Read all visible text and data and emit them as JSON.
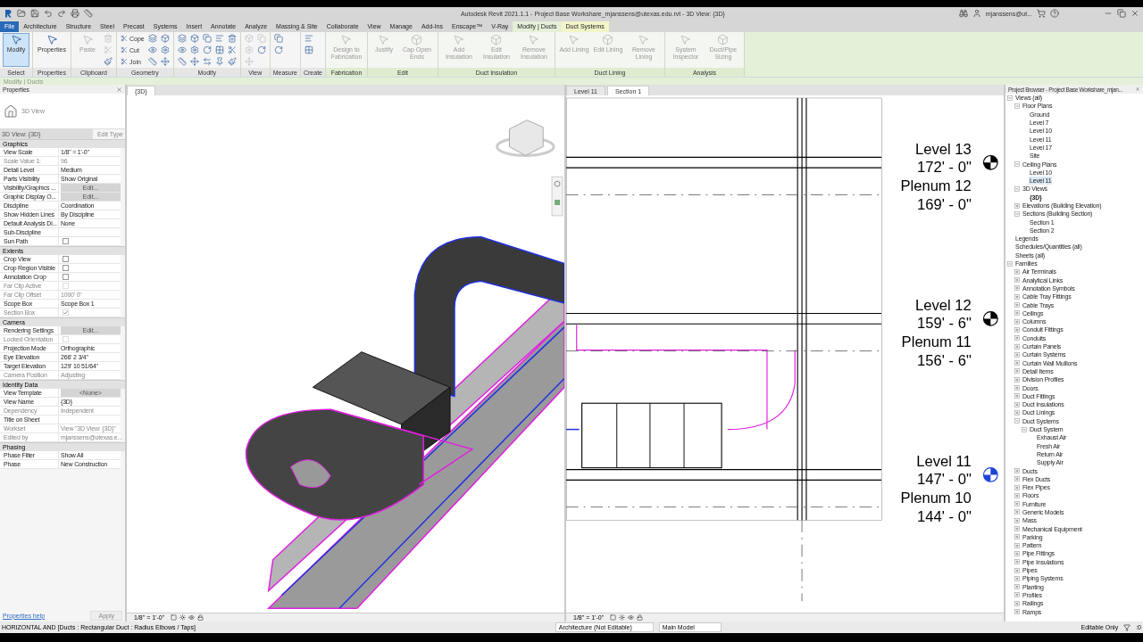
{
  "title_bar": {
    "title": "Autodesk Revit 2021.1.1 - Project Base Workshare_mjanssens@utexas.edu.rvt - 3D View: {3D}",
    "user": "mjanssens@ut..."
  },
  "ribbon_tabs": [
    {
      "label": "File",
      "kind": "file",
      "selected": false
    },
    {
      "label": "Architecture",
      "kind": "normal",
      "selected": false
    },
    {
      "label": "Structure",
      "kind": "normal",
      "selected": false
    },
    {
      "label": "Steel",
      "kind": "normal",
      "selected": false
    },
    {
      "label": "Precast",
      "kind": "normal",
      "selected": false
    },
    {
      "label": "Systems",
      "kind": "normal",
      "selected": false
    },
    {
      "label": "Insert",
      "kind": "normal",
      "selected": false
    },
    {
      "label": "Annotate",
      "kind": "normal",
      "selected": false
    },
    {
      "label": "Analyze",
      "kind": "normal",
      "selected": false
    },
    {
      "label": "Massing & Site",
      "kind": "normal",
      "selected": false
    },
    {
      "label": "Collaborate",
      "kind": "normal",
      "selected": false
    },
    {
      "label": "View",
      "kind": "normal",
      "selected": false
    },
    {
      "label": "Manage",
      "kind": "normal",
      "selected": false
    },
    {
      "label": "Add-Ins",
      "kind": "normal",
      "selected": false
    },
    {
      "label": "Enscape™",
      "kind": "normal",
      "selected": false
    },
    {
      "label": "V-Ray",
      "kind": "normal",
      "selected": false
    },
    {
      "label": "Modify | Ducts",
      "kind": "contextual",
      "selected": true
    },
    {
      "label": "Duct Systems",
      "kind": "contextual",
      "selected": false
    }
  ],
  "ribbon_panels": [
    {
      "label": "Select",
      "kind": "general",
      "tools": [
        {
          "kind": "large",
          "label": "Modify",
          "disabled": false,
          "selected": true
        }
      ]
    },
    {
      "label": "Properties",
      "kind": "general",
      "tools": [
        {
          "kind": "large",
          "label": "Properties",
          "disabled": false,
          "selected": false
        }
      ]
    },
    {
      "label": "Clipboard",
      "kind": "general",
      "tools": [
        {
          "kind": "large",
          "label": "Paste",
          "disabled": true,
          "selected": false
        },
        {
          "kind": "icon",
          "disabled": true
        },
        {
          "kind": "icon",
          "disabled": true
        },
        {
          "kind": "icon",
          "disabled": false
        }
      ]
    },
    {
      "label": "Geometry",
      "kind": "general",
      "tools": [
        {
          "kind": "small",
          "label": "Cope",
          "disabled": false
        },
        {
          "kind": "small",
          "label": "Cut",
          "disabled": false
        },
        {
          "kind": "small",
          "label": "Join",
          "disabled": false
        },
        {
          "kind": "icon",
          "disabled": false
        },
        {
          "kind": "icon",
          "disabled": false
        },
        {
          "kind": "icon",
          "disabled": false
        },
        {
          "kind": "icon",
          "disabled": false
        },
        {
          "kind": "icon",
          "disabled": false
        },
        {
          "kind": "icon",
          "disabled": false
        }
      ]
    },
    {
      "label": "Modify",
      "kind": "general",
      "tools": [
        {
          "kind": "icon",
          "disabled": false
        },
        {
          "kind": "icon",
          "disabled": false
        },
        {
          "kind": "icon",
          "disabled": false
        },
        {
          "kind": "icon",
          "disabled": false
        },
        {
          "kind": "icon",
          "disabled": false
        },
        {
          "kind": "icon",
          "disabled": false
        },
        {
          "kind": "icon",
          "disabled": false
        },
        {
          "kind": "icon",
          "disabled": false
        },
        {
          "kind": "icon",
          "disabled": false
        },
        {
          "kind": "icon",
          "disabled": false
        },
        {
          "kind": "icon",
          "disabled": false
        },
        {
          "kind": "icon",
          "disabled": false
        },
        {
          "kind": "icon",
          "disabled": false
        },
        {
          "kind": "icon",
          "disabled": false
        },
        {
          "kind": "icon",
          "disabled": false
        }
      ]
    },
    {
      "label": "View",
      "kind": "general",
      "tools": [
        {
          "kind": "icon",
          "disabled": true
        },
        {
          "kind": "icon",
          "disabled": true
        },
        {
          "kind": "icon",
          "disabled": true
        },
        {
          "kind": "icon",
          "disabled": true
        },
        {
          "kind": "icon",
          "disabled": false
        }
      ]
    },
    {
      "label": "Measure",
      "kind": "general",
      "tools": [
        {
          "kind": "icon",
          "disabled": false
        },
        {
          "kind": "icon",
          "disabled": false
        }
      ]
    },
    {
      "label": "Create",
      "kind": "general",
      "tools": [
        {
          "kind": "icon",
          "disabled": false
        },
        {
          "kind": "icon",
          "disabled": false
        }
      ]
    },
    {
      "label": "Fabrication",
      "kind": "contextual",
      "tools": [
        {
          "kind": "large",
          "label": "Design to Fabrication",
          "disabled": true,
          "selected": false
        }
      ]
    },
    {
      "label": "Edit",
      "kind": "contextual",
      "tools": [
        {
          "kind": "large",
          "label": "Justify",
          "disabled": true,
          "selected": false
        },
        {
          "kind": "large",
          "label": "Cap Open Ends",
          "disabled": true,
          "selected": false
        }
      ]
    },
    {
      "label": "Duct Insulation",
      "kind": "contextual",
      "tools": [
        {
          "kind": "large",
          "label": "Add Insulation",
          "disabled": true,
          "selected": false
        },
        {
          "kind": "large",
          "label": "Edit Insulation",
          "disabled": true,
          "selected": false
        },
        {
          "kind": "large",
          "label": "Remove Insulation",
          "disabled": true,
          "selected": false
        }
      ]
    },
    {
      "label": "Duct Lining",
      "kind": "contextual",
      "tools": [
        {
          "kind": "large",
          "label": "Add Lining",
          "disabled": true,
          "selected": false
        },
        {
          "kind": "large",
          "label": "Edit Lining",
          "disabled": true,
          "selected": false
        },
        {
          "kind": "large",
          "label": "Remove Lining",
          "disabled": true,
          "selected": false
        }
      ]
    },
    {
      "label": "Analysis",
      "kind": "contextual",
      "tools": [
        {
          "kind": "large",
          "label": "System Inspector",
          "disabled": true,
          "selected": false
        },
        {
          "kind": "large",
          "label": "Duct/Pipe Sizing",
          "disabled": true,
          "selected": false
        }
      ]
    }
  ],
  "context_bar": "Modify | Ducts",
  "properties": {
    "title": "Properties",
    "type_name": "3D View",
    "instance": "3D View: {3D}",
    "edit_type": "Edit Type",
    "groups": [
      {
        "title": "Graphics",
        "rows": [
          {
            "label": "View Scale",
            "value": "1/8\" = 1'-0\"",
            "kind": "text",
            "disabled": false
          },
          {
            "label": "Scale Value    1:",
            "value": "96",
            "kind": "text",
            "disabled": true
          },
          {
            "label": "Detail Level",
            "value": "Medium",
            "kind": "text",
            "disabled": false
          },
          {
            "label": "Parts Visibility",
            "value": "Show Original",
            "kind": "text",
            "disabled": false
          },
          {
            "label": "Visibility/Graphics ...",
            "value": "Edit...",
            "kind": "button",
            "disabled": false
          },
          {
            "label": "Graphic Display O...",
            "value": "Edit...",
            "kind": "button",
            "disabled": false
          },
          {
            "label": "Discipline",
            "value": "Coordination",
            "kind": "text",
            "disabled": false
          },
          {
            "label": "Show Hidden Lines",
            "value": "By Discipline",
            "kind": "text",
            "disabled": false
          },
          {
            "label": "Default Analysis Di...",
            "value": "None",
            "kind": "text",
            "disabled": false
          },
          {
            "label": "Sub-Discipline",
            "kind": "text",
            "disabled": false
          },
          {
            "label": "Sun Path",
            "kind": "checkbox",
            "checked": false,
            "disabled": false
          }
        ]
      },
      {
        "title": "Extents",
        "rows": [
          {
            "label": "Crop View",
            "kind": "checkbox",
            "checked": false,
            "disabled": false
          },
          {
            "label": "Crop Region Visible",
            "kind": "checkbox",
            "checked": false,
            "disabled": false
          },
          {
            "label": "Annotation Crop",
            "kind": "checkbox",
            "checked": false,
            "disabled": false
          },
          {
            "label": "Far Clip Active",
            "kind": "checkbox",
            "checked": false,
            "disabled": true
          },
          {
            "label": "Far Clip Offset",
            "value": "1000'  0\"",
            "kind": "text",
            "disabled": true
          },
          {
            "label": "Scope Box",
            "value": "Scope Box 1",
            "kind": "text",
            "disabled": false
          },
          {
            "label": "Section Box",
            "kind": "checkbox",
            "checked": true,
            "disabled": true
          }
        ]
      },
      {
        "title": "Camera",
        "rows": [
          {
            "label": "Rendering Settings",
            "value": "Edit...",
            "kind": "button",
            "disabled": false
          },
          {
            "label": "Locked Orientation",
            "kind": "checkbox",
            "checked": false,
            "disabled": true
          },
          {
            "label": "Projection Mode",
            "value": "Orthographic",
            "kind": "text",
            "disabled": false
          },
          {
            "label": "Eye Elevation",
            "value": "266'  2 3/4\"",
            "kind": "text",
            "disabled": false
          },
          {
            "label": "Target Elevation",
            "value": "129'  10 51/64\"",
            "kind": "text",
            "disabled": false
          },
          {
            "label": "Camera Position",
            "value": "Adjusting",
            "kind": "text",
            "disabled": true
          }
        ]
      },
      {
        "title": "Identity Data",
        "rows": [
          {
            "label": "View Template",
            "value": "<None>",
            "kind": "button",
            "disabled": false
          },
          {
            "label": "View Name",
            "value": "{3D}",
            "kind": "text",
            "disabled": false
          },
          {
            "label": "Dependency",
            "value": "Independent",
            "kind": "text",
            "disabled": true
          },
          {
            "label": "Title on Sheet",
            "kind": "text",
            "disabled": false
          },
          {
            "label": "Workset",
            "value": "View \"3D View: {3D}\"",
            "kind": "text",
            "disabled": true
          },
          {
            "label": "Edited by",
            "value": "mjanssens@utexas.e...",
            "kind": "text",
            "disabled": true
          }
        ]
      },
      {
        "title": "Phasing",
        "rows": [
          {
            "label": "Phase Filter",
            "value": "Show All",
            "kind": "text",
            "disabled": false
          },
          {
            "label": "Phase",
            "value": "New Construction",
            "kind": "text",
            "disabled": false
          }
        ]
      }
    ],
    "help_link": "Properties help",
    "apply": "Apply"
  },
  "view_3d": {
    "tabs": [
      {
        "label": "{3D}",
        "selected": true
      }
    ],
    "scale": "1/8\" = 1'-0\""
  },
  "section_view": {
    "tabs": [
      {
        "label": "Level 11",
        "selected": false
      },
      {
        "label": "Section 1",
        "selected": true
      }
    ],
    "scale": "1/8\" = 1'-0\"",
    "levels": [
      {
        "name": "Level 13",
        "elevation": "172' - 0\"",
        "kind": "level",
        "color": "#000000"
      },
      {
        "name": "Plenum 12",
        "elevation": "169' - 0\"",
        "kind": "plenum"
      },
      {
        "name": "Level 12",
        "elevation": "159' - 6\"",
        "kind": "level",
        "color": "#000000"
      },
      {
        "name": "Plenum 11",
        "elevation": "156' - 6\"",
        "kind": "plenum"
      },
      {
        "name": "Level 11",
        "elevation": "147' - 0\"",
        "kind": "level",
        "color": "#1d46d8"
      },
      {
        "name": "Plenum 10",
        "elevation": "144' - 0\"",
        "kind": "plenum"
      }
    ]
  },
  "project_browser": {
    "title": "Project Browser - Project Base Workshare_mjan...",
    "tree": [
      {
        "label": "Views (all)",
        "expanded": true,
        "selected": false,
        "children": [
          {
            "label": "Floor Plans",
            "expanded": true,
            "selected": false,
            "children": [
              {
                "label": "Ground",
                "selected": false
              },
              {
                "label": "Level 7",
                "selected": false
              },
              {
                "label": "Level 10",
                "selected": false
              },
              {
                "label": "Level 11",
                "selected": false
              },
              {
                "label": "Level 17",
                "selected": false
              },
              {
                "label": "Site",
                "selected": false
              }
            ]
          },
          {
            "label": "Ceiling Plans",
            "expanded": true,
            "selected": false,
            "children": [
              {
                "label": "Level 10",
                "selected": false
              },
              {
                "label": "Level 11",
                "selected": true
              }
            ]
          },
          {
            "label": "3D Views",
            "expanded": true,
            "selected": false,
            "children": [
              {
                "label": "{3D}",
                "selected": false,
                "active": true
              }
            ]
          },
          {
            "label": "Elevations (Building Elevation)",
            "expanded": false,
            "selected": false
          },
          {
            "label": "Sections (Building Section)",
            "expanded": true,
            "selected": false,
            "children": [
              {
                "label": "Section 1",
                "selected": false
              },
              {
                "label": "Section 2",
                "selected": false
              }
            ]
          }
        ]
      },
      {
        "label": "Legends",
        "selected": false
      },
      {
        "label": "Schedules/Quantities (all)",
        "selected": false
      },
      {
        "label": "Sheets (all)",
        "selected": false
      },
      {
        "label": "Families",
        "expanded": true,
        "selected": false,
        "children": [
          {
            "label": "Air Terminals",
            "expanded": false,
            "selected": false
          },
          {
            "label": "Analytical Links",
            "expanded": false,
            "selected": false
          },
          {
            "label": "Annotation Symbols",
            "expanded": false,
            "selected": false
          },
          {
            "label": "Cable Tray Fittings",
            "expanded": false,
            "selected": false
          },
          {
            "label": "Cable Trays",
            "expanded": false,
            "selected": false
          },
          {
            "label": "Ceilings",
            "expanded": false,
            "selected": false
          },
          {
            "label": "Columns",
            "expanded": false,
            "selected": false
          },
          {
            "label": "Conduit Fittings",
            "expanded": false,
            "selected": false
          },
          {
            "label": "Conduits",
            "expanded": false,
            "selected": false
          },
          {
            "label": "Curtain Panels",
            "expanded": false,
            "selected": false
          },
          {
            "label": "Curtain Systems",
            "expanded": false,
            "selected": false
          },
          {
            "label": "Curtain Wall Mullions",
            "expanded": false,
            "selected": false
          },
          {
            "label": "Detail Items",
            "expanded": false,
            "selected": false
          },
          {
            "label": "Division Profiles",
            "expanded": false,
            "selected": false
          },
          {
            "label": "Doors",
            "expanded": false,
            "selected": false
          },
          {
            "label": "Duct Fittings",
            "expanded": false,
            "selected": false
          },
          {
            "label": "Duct Insulations",
            "expanded": false,
            "selected": false
          },
          {
            "label": "Duct Linings",
            "expanded": false,
            "selected": false
          },
          {
            "label": "Duct Systems",
            "expanded": true,
            "selected": false,
            "children": [
              {
                "label": "Duct System",
                "expanded": true,
                "selected": false,
                "children": [
                  {
                    "label": "Exhaust Air",
                    "selected": false
                  },
                  {
                    "label": "Fresh Air",
                    "selected": false
                  },
                  {
                    "label": "Return Air",
                    "selected": false
                  },
                  {
                    "label": "Supply Air",
                    "selected": false
                  }
                ]
              }
            ]
          },
          {
            "label": "Ducts",
            "expanded": false,
            "selected": false
          },
          {
            "label": "Flex Ducts",
            "expanded": false,
            "selected": false
          },
          {
            "label": "Flex Pipes",
            "expanded": false,
            "selected": false
          },
          {
            "label": "Floors",
            "expanded": false,
            "selected": false
          },
          {
            "label": "Furniture",
            "expanded": false,
            "selected": false
          },
          {
            "label": "Generic Models",
            "expanded": false,
            "selected": false
          },
          {
            "label": "Mass",
            "expanded": false,
            "selected": false
          },
          {
            "label": "Mechanical Equipment",
            "expanded": false,
            "selected": false
          },
          {
            "label": "Parking",
            "expanded": false,
            "selected": false
          },
          {
            "label": "Pattern",
            "expanded": false,
            "selected": false
          },
          {
            "label": "Pipe Fittings",
            "expanded": false,
            "selected": false
          },
          {
            "label": "Pipe Insulations",
            "expanded": false,
            "selected": false
          },
          {
            "label": "Pipes",
            "expanded": false,
            "selected": false
          },
          {
            "label": "Piping Systems",
            "expanded": false,
            "selected": false
          },
          {
            "label": "Planting",
            "expanded": false,
            "selected": false
          },
          {
            "label": "Profiles",
            "expanded": false,
            "selected": false
          },
          {
            "label": "Railings",
            "expanded": false,
            "selected": false
          },
          {
            "label": "Ramps",
            "expanded": false,
            "selected": false
          }
        ]
      }
    ]
  },
  "status_bar": {
    "message": "HORIZONTAL AND [Ducts : Rectangular Duct : Radius Elbows / Taps]",
    "workset": "Architecture (Not Editable)",
    "design_option": "Main Model",
    "editable": "Editable Only",
    "filter_count": ":0"
  }
}
